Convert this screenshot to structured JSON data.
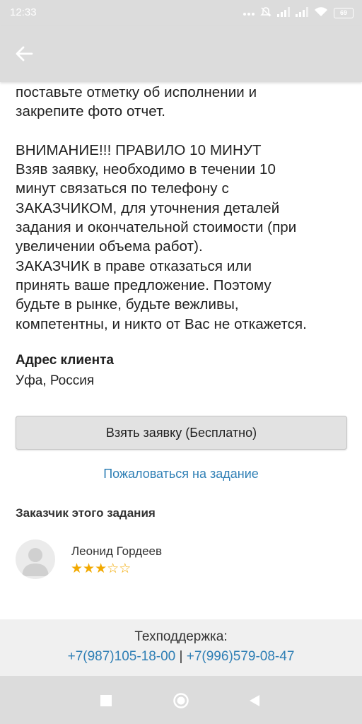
{
  "status_bar": {
    "time": "12:33",
    "battery": "69",
    "icons": [
      "more-dots-icon",
      "mute-icon",
      "signal-icon",
      "signal-icon",
      "wifi-icon",
      "battery-icon"
    ]
  },
  "app_bar": {
    "back_icon": "back-arrow-icon"
  },
  "task": {
    "description_lines": [
      "поставьте отметку об исполнении и",
      "закрепите фото отчет.",
      "",
      "ВНИМАНИЕ!!! ПРАВИЛО 10 МИНУТ",
      "Взяв заявку, необходимо в течении 10",
      "минут связаться по телефону с",
      "ЗАКАЗЧИКОМ, для уточнения деталей",
      "задания и окончательной стоимости (при",
      "увеличении объема работ).",
      "ЗАКАЗЧИК в праве отказаться или",
      "принять ваше предложение. Поэтому",
      "будьте в рынке, будьте вежливы,",
      "компетентны, и никто от Вас не откажется."
    ],
    "address_title": "Адрес клиента",
    "address_value": "Уфа, Россия",
    "take_button_label": "Взять заявку (Бесплатно)",
    "complain_link": "Пожаловаться на задание"
  },
  "customer": {
    "section_title": "Заказчик этого задания",
    "name": "Леонид Гордеев",
    "rating": 3,
    "rating_max": 5,
    "star_color": "#f2a900"
  },
  "support": {
    "title": "Техподдержка:",
    "phone1": "+7(987)105-18-00",
    "separator": "|",
    "phone2": "+7(996)579-08-47"
  },
  "nav_bar": {
    "icons": [
      "recents-square-icon",
      "home-circle-icon",
      "back-triangle-icon"
    ]
  }
}
